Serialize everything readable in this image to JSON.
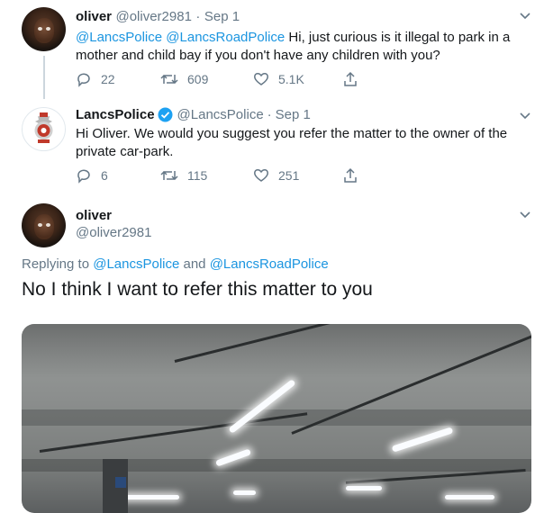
{
  "tweet1": {
    "name": "oliver",
    "handle": "@oliver2981",
    "sep": "·",
    "date": "Sep 1",
    "mention1": "@LancsPolice",
    "mention2": "@LancsRoadPolice",
    "text_line1": "Hi, just curious is it illegal to park in a",
    "text_line2": "mother and child bay if you don't have any children with you?",
    "replies": "22",
    "retweets": "609",
    "likes": "5.1K"
  },
  "tweet2": {
    "name": "LancsPolice",
    "handle": "@LancsPolice",
    "sep": "·",
    "date": "Sep 1",
    "text_line1": "Hi Oliver. We would you suggest you refer the matter to the owner of the",
    "text_line2": "private car-park.",
    "replies": "6",
    "retweets": "115",
    "likes": "251"
  },
  "tweet3": {
    "name": "oliver",
    "handle": "@oliver2981",
    "replying_prefix": "Replying to",
    "replying_mention1": "@LancsPolice",
    "replying_and": "and",
    "replying_mention2": "@LancsRoadPolice",
    "text": "No I think I want to refer this matter to you"
  },
  "colors": {
    "accent": "#1b95e0",
    "secondary_text": "#657786",
    "verified": "#1da1f2"
  },
  "icons": [
    "reply-icon",
    "retweet-icon",
    "like-icon",
    "share-icon",
    "chevron-down-icon",
    "verified-icon"
  ]
}
